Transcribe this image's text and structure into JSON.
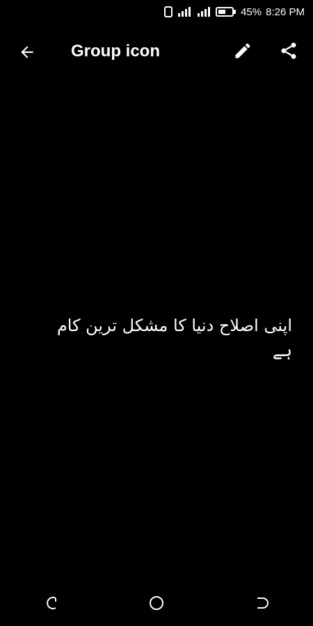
{
  "status": {
    "battery_percent": "45%",
    "time": "8:26 PM"
  },
  "app_bar": {
    "title": "Group icon",
    "icons": {
      "back": "arrow-back-icon",
      "edit": "pencil-icon",
      "share": "share-icon"
    }
  },
  "image": {
    "caption_text": "اپنی اصلاح دنیا کا مشکل ترین کام ہے"
  },
  "nav": {
    "icons": [
      "recent-apps-icon",
      "home-icon",
      "back-icon"
    ]
  }
}
